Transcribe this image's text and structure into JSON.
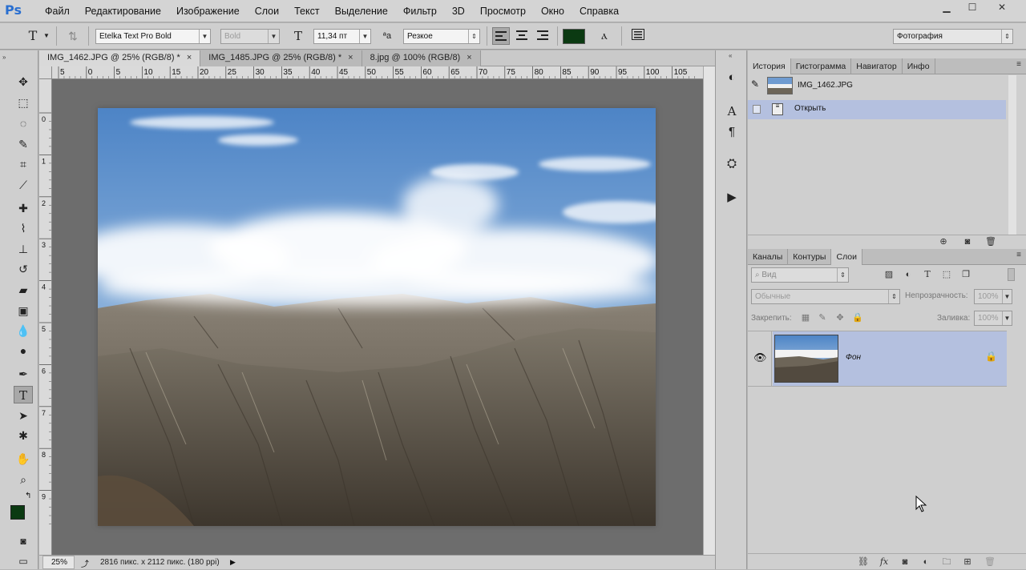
{
  "app": {
    "logo": "Ps"
  },
  "menu": [
    "Файл",
    "Редактирование",
    "Изображение",
    "Слои",
    "Текст",
    "Выделение",
    "Фильтр",
    "3D",
    "Просмотр",
    "Окно",
    "Справка"
  ],
  "window_controls": {
    "minimize": "▁",
    "maximize": "☐",
    "close": "✕"
  },
  "options": {
    "tool_glyph": "T",
    "orient_glyph": "⇅",
    "font_family": "Etelka Text Pro Bold",
    "font_style": "Bold",
    "font_size_glyph": "T",
    "font_size": "11,34 пт",
    "aa_glyph": "ªa",
    "antialias": "Резкое",
    "color": "#0b3a12",
    "workspace": "Фотография"
  },
  "tabs": [
    {
      "label": "IMG_1462.JPG @ 25% (RGB/8) *",
      "close": "×"
    },
    {
      "label": "IMG_1485.JPG @ 25% (RGB/8) *",
      "close": "×"
    },
    {
      "label": "8.jpg @ 100% (RGB/8)",
      "close": "×"
    }
  ],
  "ruler_h": [
    "5",
    "0",
    "5",
    "10",
    "15",
    "20",
    "25",
    "30",
    "35",
    "40",
    "45",
    "50",
    "55",
    "60",
    "65",
    "70",
    "75",
    "80",
    "85",
    "90",
    "95",
    "100",
    "105"
  ],
  "ruler_v": [
    "0",
    "1",
    "2",
    "3",
    "4",
    "5",
    "6",
    "7",
    "8",
    "9"
  ],
  "status": {
    "zoom": "25%",
    "info": "2816 пикс. x 2112 пикс. (180 ppi)",
    "arrow": "▶"
  },
  "history": {
    "tabs": [
      "История",
      "Гистограмма",
      "Навигатор",
      "Инфо"
    ],
    "snapshot": "IMG_1462.JPG",
    "items": [
      "Открыть"
    ]
  },
  "layers_panel": {
    "tabs": [
      "Каналы",
      "Контуры",
      "Слои"
    ],
    "filter_placeholder": "Вид",
    "blend_mode": "Обычные",
    "opacity_label": "Непрозрачность:",
    "opacity": "100%",
    "lock_label": "Закрепить:",
    "fill_label": "Заливка:",
    "fill": "100%",
    "layers": [
      {
        "name": "Фон"
      }
    ]
  },
  "colors": {
    "foreground": "#0b3a12",
    "background": "#ffffff",
    "selection": "#b4c0df"
  }
}
